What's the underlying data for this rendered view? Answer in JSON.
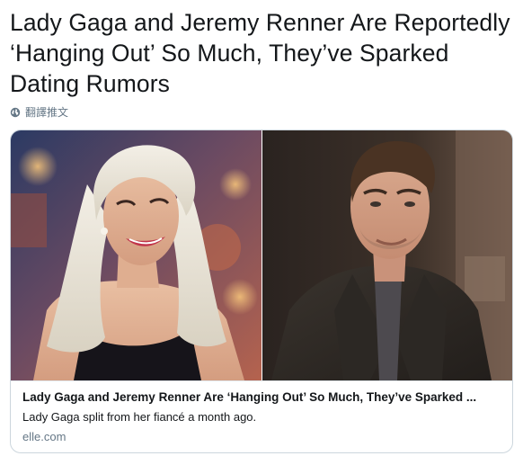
{
  "tweet": {
    "text": "Lady Gaga and Jeremy Renner Are Reportedly ‘Hanging Out’ So Much, They’ve Sparked Dating Rumors",
    "translate_label": "翻譯推文"
  },
  "card": {
    "title": "Lady Gaga and Jeremy Renner Are ‘Hanging Out’ So Much, They’ve Sparked ...",
    "description": "Lady Gaga split from her fiancé a month ago.",
    "domain": "elle.com",
    "images": [
      {
        "subject": "woman with platinum blonde hair smiling, black sequin dress"
      },
      {
        "subject": "man with short dark hair in dark coat"
      }
    ]
  },
  "colors": {
    "text": "#14171a",
    "muted": "#657786",
    "border": "#ccd6dd"
  },
  "icons": {
    "translate": "globe-icon"
  }
}
